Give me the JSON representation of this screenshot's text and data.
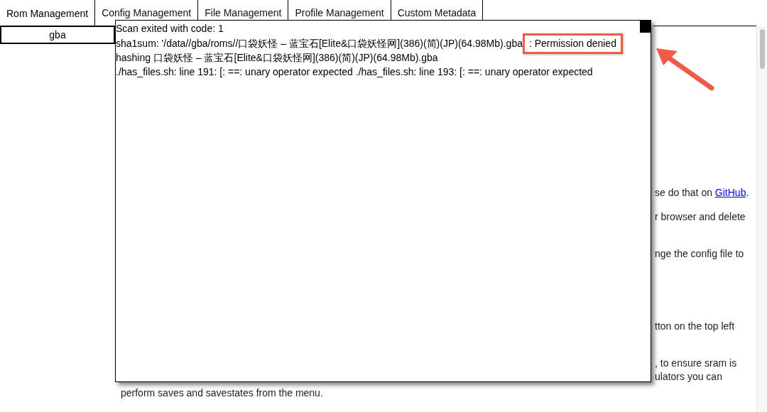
{
  "tabs": [
    {
      "label": "Rom Management",
      "selected": true
    },
    {
      "label": "Config Management",
      "selected": false
    },
    {
      "label": "File Management",
      "selected": false
    },
    {
      "label": "Profile Management",
      "selected": false
    },
    {
      "label": "Custom Metadata",
      "selected": false
    }
  ],
  "subtabs": [
    {
      "label": "gba",
      "selected": true
    }
  ],
  "background_text": [
    {
      "text": "se do that on ",
      "link": "GitHub",
      "after": "."
    },
    {
      "text": "r browser and delete"
    },
    {
      "text": "nge the config file to"
    },
    {
      "text": "tton on the top left"
    },
    {
      "text": ", to ensure sram is"
    },
    {
      "text": "ulators you can"
    }
  ],
  "background_footer": "perform saves and savestates from the menu.",
  "log_dialog": {
    "lines": [
      {
        "text": "Scan exited with code: 1"
      },
      {
        "text": "sha1sum: '/data//gba/roms//口袋妖怪 – 蓝宝石[Elite&口袋妖怪网](386)(简)(JP)(64.98Mb).gba",
        "highlight": ": Permission denied"
      },
      {
        "text": "hashing 口袋妖怪 – 蓝宝石[Elite&口袋妖怪网](386)(简)(JP)(64.98Mb).gba"
      },
      {
        "text": "./has_files.sh: line 191: [: ==: unary operator expected ./has_files.sh: line 193: [: ==: unary operator expected"
      }
    ]
  }
}
